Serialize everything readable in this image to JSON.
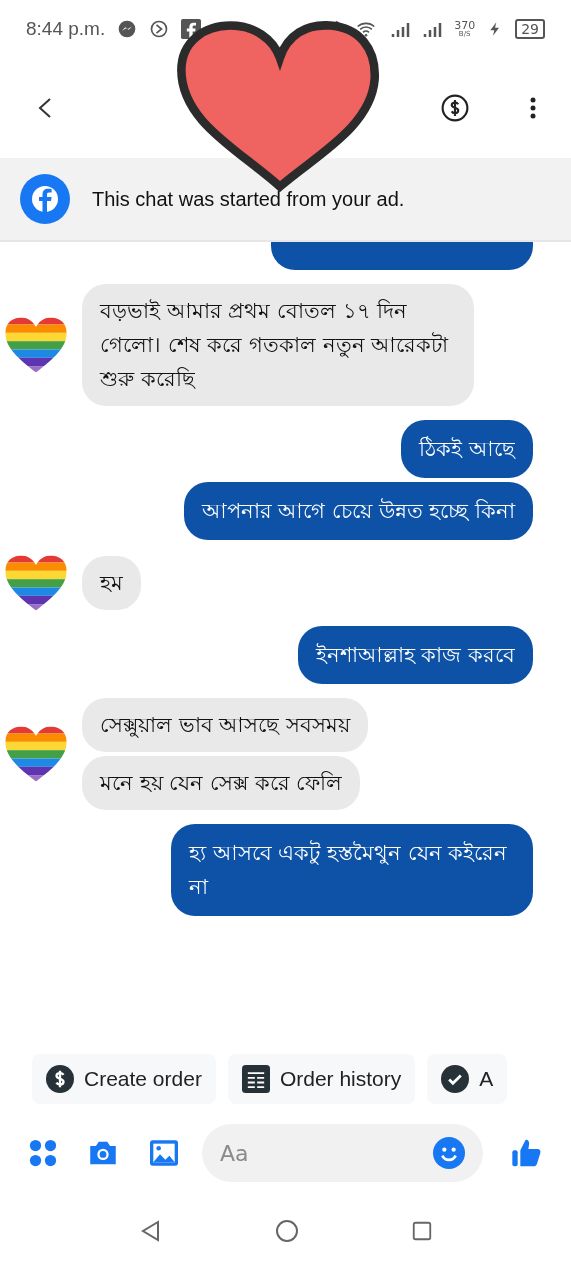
{
  "status_bar": {
    "time": "8:44 p.m.",
    "speed": "370",
    "speed_unit": "B/S",
    "battery": "29"
  },
  "banner": {
    "text": "This chat was started from your ad."
  },
  "messages": [
    {
      "kind": "received",
      "text": "বড়ভাই আমার প্রথম বোতল ১৭ দিন গেলো। শেষ করে গতকাল নতুন আরেকটা শুরু করেছি"
    },
    {
      "kind": "sent",
      "text": "ঠিকই আছে"
    },
    {
      "kind": "sent",
      "text": "আপনার আগে চেয়ে উন্নত হচ্ছে কিনা"
    },
    {
      "kind": "received",
      "text": "হম"
    },
    {
      "kind": "sent",
      "text": "ইনশাআল্লাহ কাজ করবে"
    },
    {
      "kind": "received",
      "text": "সেক্সুয়াল ভাব আসছে সবসময়"
    },
    {
      "kind": "received",
      "text": "মনে হয় যেন সেক্স করে ফেলি"
    },
    {
      "kind": "sent",
      "text": "হ্য আসবে একটু হস্তমৈথুন যেন কইরেন না"
    }
  ],
  "quick_replies": [
    {
      "kind": "dollar",
      "label": "Create order"
    },
    {
      "kind": "list",
      "label": "Order history"
    },
    {
      "kind": "check",
      "label": "A"
    }
  ],
  "composer": {
    "placeholder": "Aa"
  }
}
